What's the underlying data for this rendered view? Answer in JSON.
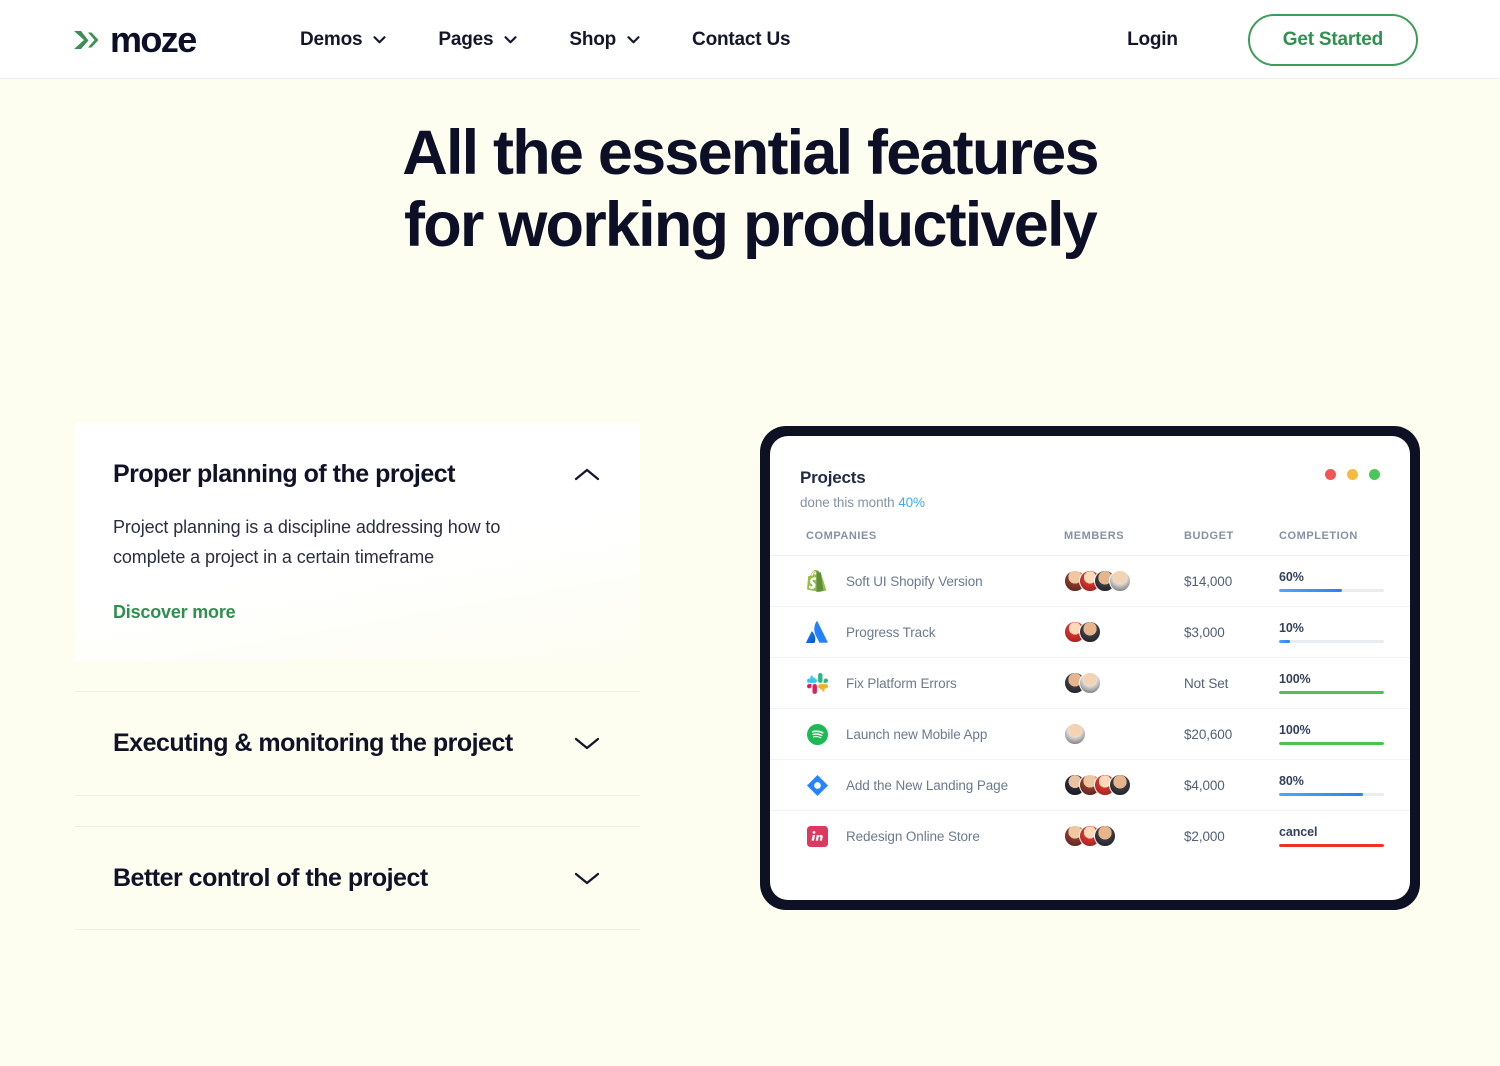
{
  "header": {
    "logo_text": "moze",
    "logo_mark": "x-mark-green",
    "nav": [
      {
        "label": "Demos",
        "has_dropdown": true
      },
      {
        "label": "Pages",
        "has_dropdown": true
      },
      {
        "label": "Shop",
        "has_dropdown": true
      },
      {
        "label": "Contact Us",
        "has_dropdown": false
      }
    ],
    "login_label": "Login",
    "cta_label": "Get Started"
  },
  "hero": {
    "heading": "All the essential features for working productively"
  },
  "accordion": [
    {
      "title": "Proper planning of the project",
      "open": true,
      "body": "Project planning is a discipline addressing how to complete a project in a certain timeframe",
      "link_label": "Discover more",
      "icon": "chevron-up-icon"
    },
    {
      "title": "Executing & monitoring the project",
      "open": false,
      "icon": "chevron-down-icon"
    },
    {
      "title": "Better control of the project",
      "open": false,
      "icon": "chevron-down-icon"
    }
  ],
  "dashboard": {
    "title": "Projects",
    "subtitle_prefix": "done this month",
    "subtitle_value": "40%",
    "window_dots": [
      {
        "name": "close-dot",
        "color": "#f05654"
      },
      {
        "name": "minimize-dot",
        "color": "#f7bb3c"
      },
      {
        "name": "maximize-dot",
        "color": "#4cc65a"
      }
    ],
    "columns": [
      "COMPANIES",
      "MEMBERS",
      "BUDGET",
      "COMPLETION"
    ],
    "rows": [
      {
        "icon": "shopify-icon",
        "company": "Soft UI Shopify Version",
        "members": 4,
        "budget": "$14,000",
        "completion_label": "60%",
        "completion_pct": 60,
        "bar_color": "#2f7ff0",
        "bar_style": "track"
      },
      {
        "icon": "atlassian-icon",
        "company": "Progress Track",
        "members": 2,
        "budget": "$3,000",
        "completion_label": "10%",
        "completion_pct": 10,
        "bar_color": "#2f7ff0",
        "bar_style": "track"
      },
      {
        "icon": "slack-icon",
        "company": "Fix Platform Errors",
        "members": 2,
        "budget": "Not Set",
        "completion_label": "100%",
        "completion_pct": 100,
        "bar_color": "#4ec24e",
        "bar_style": "full"
      },
      {
        "icon": "spotify-icon",
        "company": "Launch new Mobile App",
        "members": 1,
        "budget": "$20,600",
        "completion_label": "100%",
        "completion_pct": 100,
        "bar_color": "#4ec24e",
        "bar_style": "full"
      },
      {
        "icon": "jira-icon",
        "company": "Add the New Landing Page",
        "members": 4,
        "budget": "$4,000",
        "completion_label": "80%",
        "completion_pct": 80,
        "bar_color": "#2f7ff0",
        "bar_style": "track"
      },
      {
        "icon": "invision-icon",
        "company": "Redesign Online Store",
        "members": 3,
        "budget": "$2,000",
        "completion_label": "cancel",
        "completion_pct": 100,
        "bar_color": "#f0312b",
        "bar_style": "full"
      }
    ]
  },
  "colors": {
    "page_bg": "#fdfdf0",
    "brand_green": "#2f9150",
    "heading_navy": "#0d0f26",
    "frame_dark": "#0e1024",
    "accent_blue": "#3fa9f5"
  }
}
